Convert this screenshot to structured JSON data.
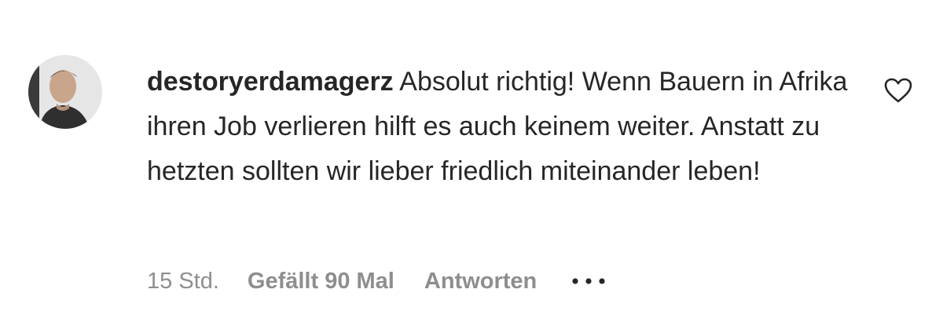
{
  "comment": {
    "username": "destoryerdamagerz",
    "text": "Absolut richtig! Wenn Bauern in Afrika ihren Job verlieren hilft es auch keinem weiter. Anstatt zu hetzten sollten wir lieber friedlich miteinander leben!",
    "time": "15 Std.",
    "likes": "Gefällt 90 Mal",
    "reply_label": "Antworten",
    "more_icon": "more-options-icon",
    "like_icon": "heart-outline-icon",
    "avatar_icon": "profile-avatar"
  },
  "colors": {
    "text": "#262626",
    "secondary": "#8e8e8e",
    "background": "#ffffff"
  }
}
